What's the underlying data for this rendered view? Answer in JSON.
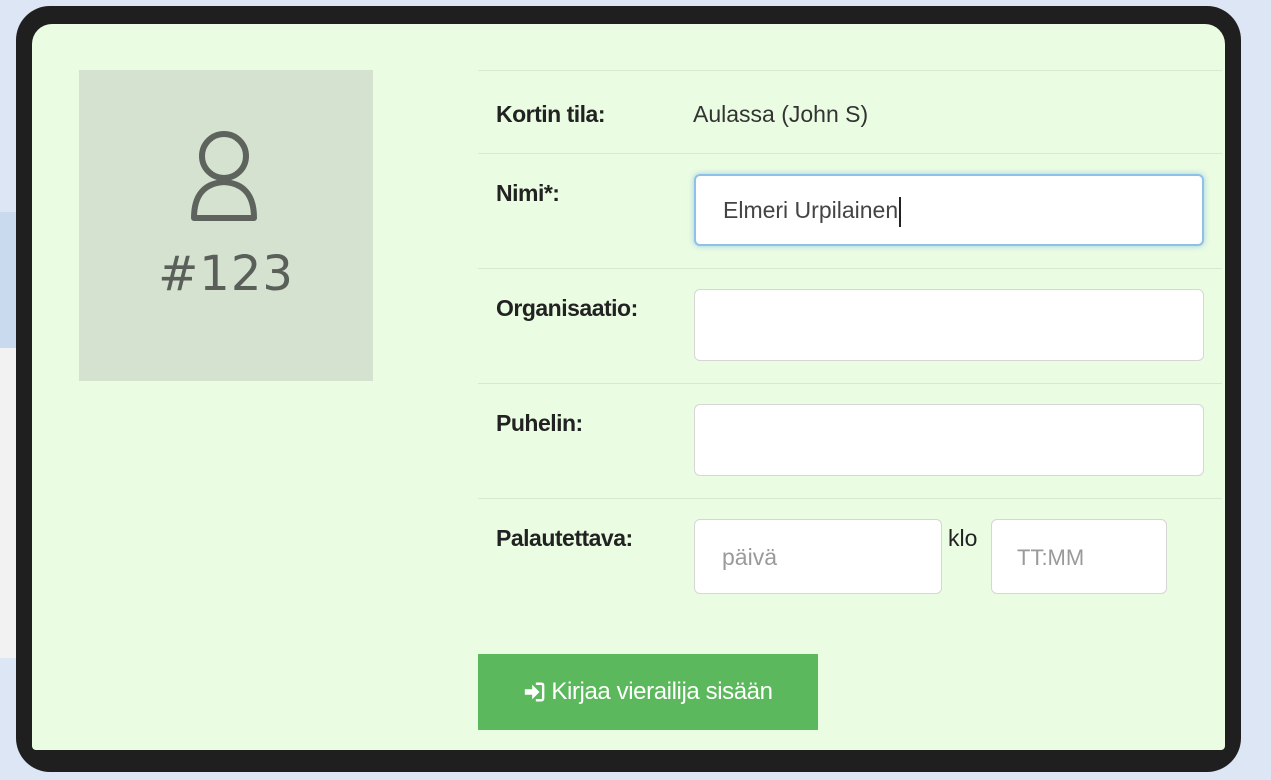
{
  "visitor_card": {
    "number": "#123",
    "avatar_icon": "user-outline-icon"
  },
  "form": {
    "status_label": "Kortin tila:",
    "status_value": "Aulassa (John S)",
    "name_label": "Nimi*:",
    "name_value": "Elmeri Urpilainen",
    "organization_label": "Organisaatio:",
    "organization_value": "",
    "phone_label": "Puhelin:",
    "phone_value": "",
    "return_label": "Palautettava:",
    "return_date_placeholder": "päivä",
    "klo_label": "klo",
    "return_time_placeholder": "TT:MM",
    "submit_label": "Kirjaa vierailija sisään",
    "submit_icon": "sign-in-icon"
  },
  "colors": {
    "panel_bg": "#eafce2",
    "avatar_bg": "#d4e2cf",
    "submit_bg": "#5cb85c",
    "focus_border": "#8fc0ea"
  }
}
